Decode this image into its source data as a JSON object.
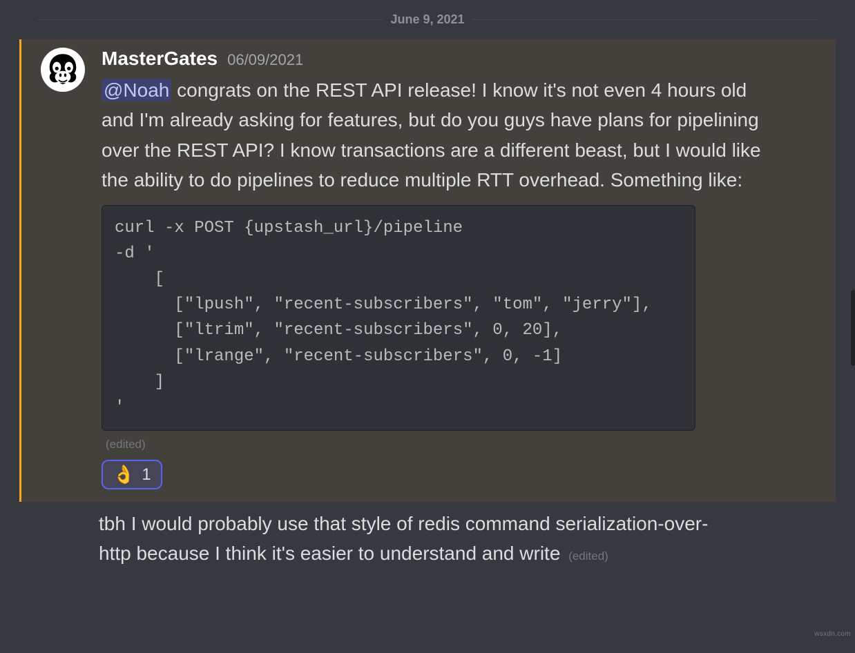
{
  "divider": {
    "date_label": "June 9, 2021"
  },
  "message": {
    "username": "MasterGates",
    "timestamp": "06/09/2021",
    "mention": "@Noah",
    "body_after_mention": " congrats on the REST API release! I know it's not even 4 hours old and I'm already asking for features, but do you guys have plans for pipelining over the REST API? I know transactions are a different beast, but I would like the ability to do pipelines to reduce multiple RTT overhead. Something like:",
    "code": "curl -x POST {upstash_url}/pipeline\n-d '\n    [\n      [\"lpush\", \"recent-subscribers\", \"tom\", \"jerry\"],\n      [\"ltrim\", \"recent-subscribers\", 0, 20],\n      [\"lrange\", \"recent-subscribers\", 0, -1]\n    ]\n'",
    "edited_label": "(edited)",
    "reaction": {
      "emoji": "👌",
      "count": "1"
    }
  },
  "followup": {
    "text": "tbh I would probably use that style of redis command serialization-over-http because I think it's easier to understand and write",
    "edited_label": "(edited)"
  },
  "watermark": "wsxdn.com"
}
